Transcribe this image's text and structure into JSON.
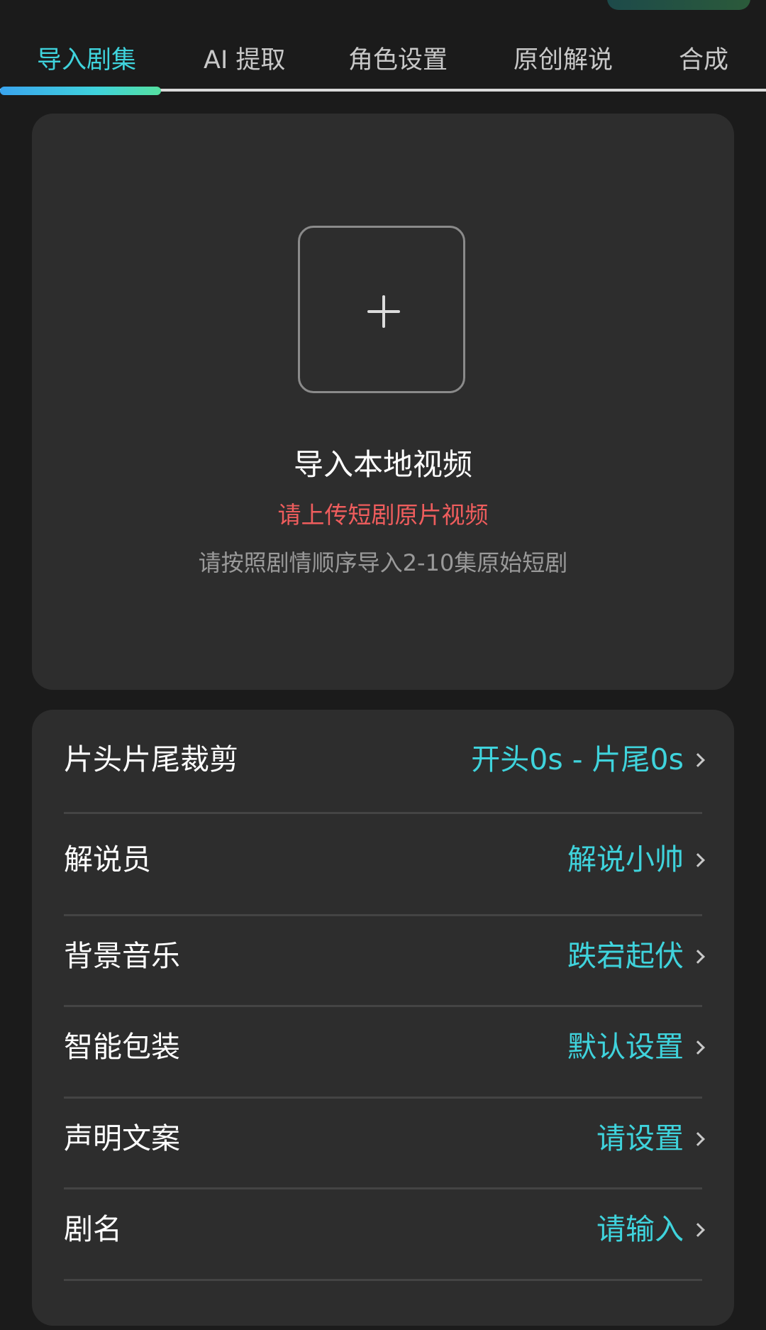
{
  "tabs": [
    {
      "label": "导入剧集",
      "active": true
    },
    {
      "label": "AI 提取",
      "active": false
    },
    {
      "label": "角色设置",
      "active": false
    },
    {
      "label": "原创解说",
      "active": false
    },
    {
      "label": "合成",
      "active": false
    }
  ],
  "upload": {
    "icon": "plus-icon",
    "title": "导入本地视频",
    "warning": "请上传短剧原片视频",
    "hint": "请按照剧情顺序导入2-10集原始短剧"
  },
  "settings": {
    "rows": [
      {
        "label": "片头片尾裁剪",
        "value": "开头0s - 片尾0s"
      },
      {
        "label": "解说员",
        "value": "解说小帅"
      },
      {
        "label": "背景音乐",
        "value": "跌宕起伏"
      },
      {
        "label": "智能包装",
        "value": "默认设置"
      },
      {
        "label": "声明文案",
        "value": "请设置"
      },
      {
        "label": "剧名",
        "value": "请输入"
      }
    ]
  },
  "colors": {
    "accent": "#3fd3dc",
    "warning": "#ef5d5d",
    "background": "#1b1b1b",
    "card": "#2d2d2d"
  }
}
